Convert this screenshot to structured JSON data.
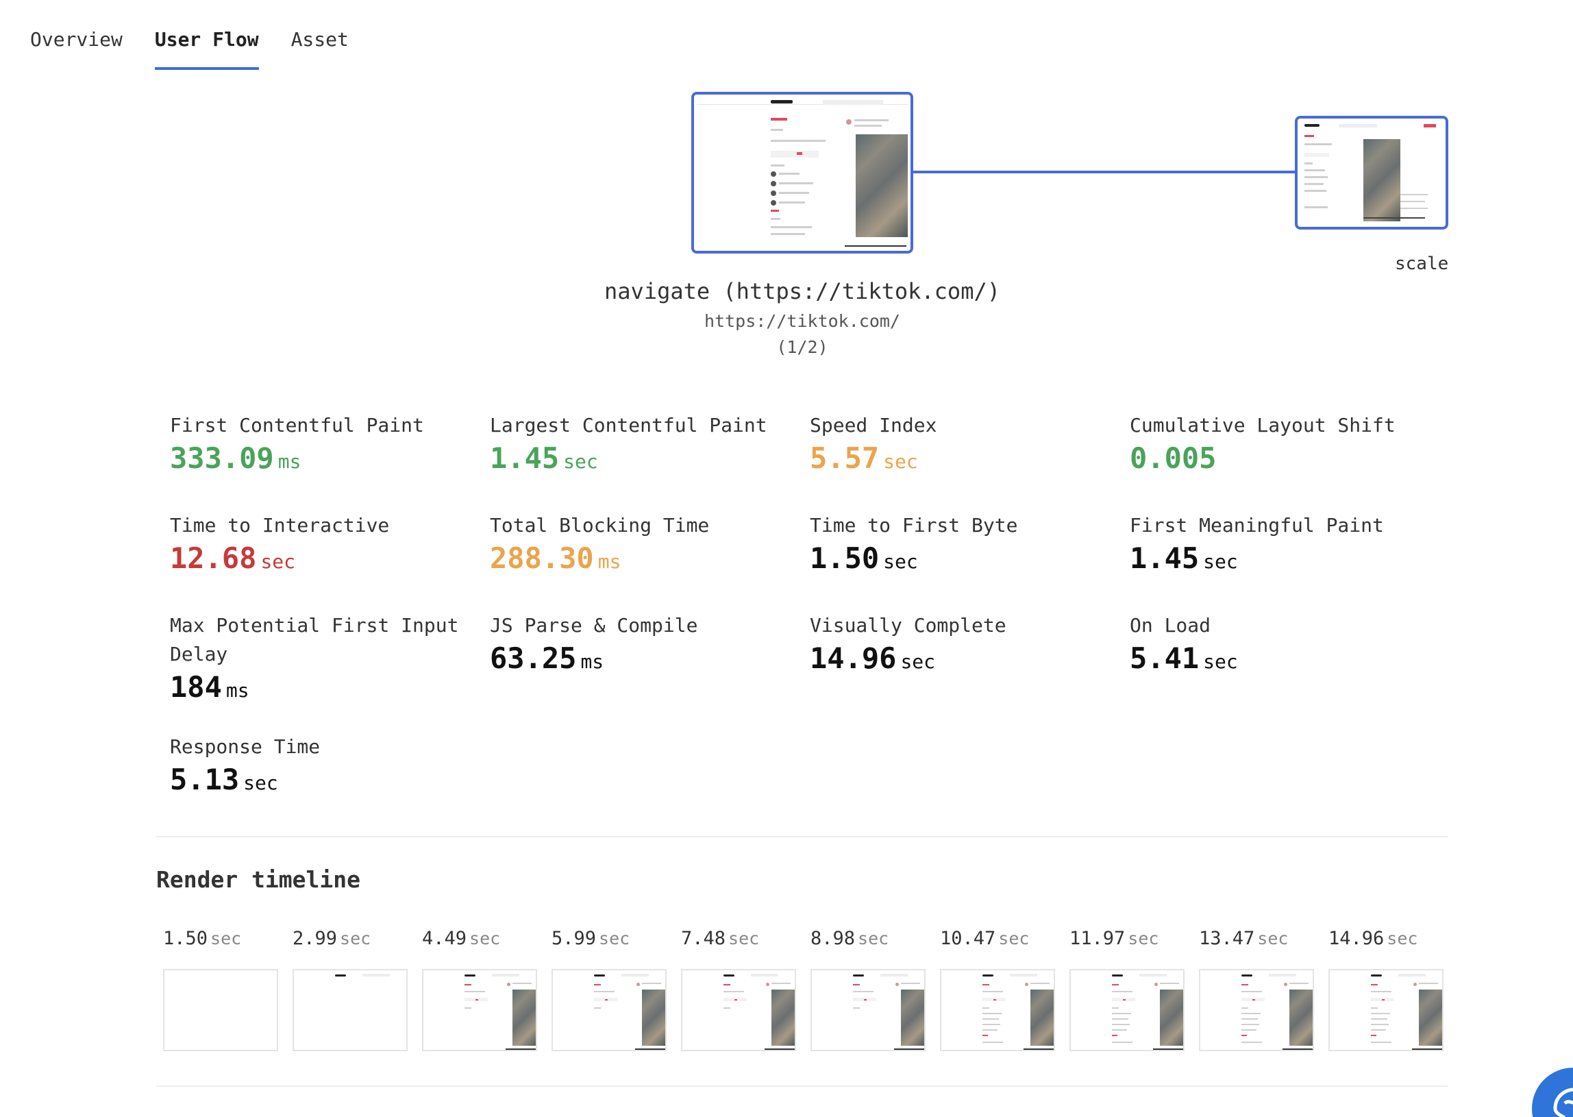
{
  "tabs": [
    {
      "label": "Overview",
      "active": false
    },
    {
      "label": "User Flow",
      "active": true
    },
    {
      "label": "Asset",
      "active": false
    }
  ],
  "flow": {
    "side_label": "scale",
    "step_title": "navigate (https://tiktok.com/)",
    "step_url": "https://tiktok.com/",
    "step_count": "(1/2)",
    "accent": "#4a6ad8"
  },
  "metrics": [
    {
      "label": "First Contentful Paint",
      "value": "333.09",
      "unit": "ms",
      "status": "good"
    },
    {
      "label": "Largest Contentful Paint",
      "value": "1.45",
      "unit": "sec",
      "status": "good"
    },
    {
      "label": "Speed Index",
      "value": "5.57",
      "unit": "sec",
      "status": "avg"
    },
    {
      "label": "Cumulative Layout Shift",
      "value": "0.005",
      "unit": "",
      "status": "good"
    },
    {
      "label": "Time to Interactive",
      "value": "12.68",
      "unit": "sec",
      "status": "bad"
    },
    {
      "label": "Total Blocking Time",
      "value": "288.30",
      "unit": "ms",
      "status": "avg"
    },
    {
      "label": "Time to First Byte",
      "value": "1.50",
      "unit": "sec",
      "status": "neutral"
    },
    {
      "label": "First Meaningful Paint",
      "value": "1.45",
      "unit": "sec",
      "status": "neutral"
    },
    {
      "label": "Max Potential First Input Delay",
      "value": "184",
      "unit": "ms",
      "status": "neutral"
    },
    {
      "label": "JS Parse & Compile",
      "value": "63.25",
      "unit": "ms",
      "status": "neutral"
    },
    {
      "label": "Visually Complete",
      "value": "14.96",
      "unit": "sec",
      "status": "neutral"
    },
    {
      "label": "On Load",
      "value": "5.41",
      "unit": "sec",
      "status": "neutral"
    },
    {
      "label": "Response Time",
      "value": "5.13",
      "unit": "sec",
      "status": "neutral"
    }
  ],
  "render_timeline": {
    "title": "Render timeline",
    "frames": [
      {
        "time": "1.50",
        "unit": "sec",
        "content": "blank"
      },
      {
        "time": "2.99",
        "unit": "sec",
        "content": "header"
      },
      {
        "time": "4.49",
        "unit": "sec",
        "content": "partial"
      },
      {
        "time": "5.99",
        "unit": "sec",
        "content": "partial"
      },
      {
        "time": "7.48",
        "unit": "sec",
        "content": "partial"
      },
      {
        "time": "8.98",
        "unit": "sec",
        "content": "partial"
      },
      {
        "time": "10.47",
        "unit": "sec",
        "content": "full"
      },
      {
        "time": "11.97",
        "unit": "sec",
        "content": "full"
      },
      {
        "time": "13.47",
        "unit": "sec",
        "content": "full"
      },
      {
        "time": "14.96",
        "unit": "sec",
        "content": "full"
      }
    ]
  },
  "status_colors": {
    "good": "#4aa35a",
    "avg": "#eba44c",
    "bad": "#c63a3a",
    "neutral": "#111111"
  },
  "fab_icon": "chat-bubble-icon"
}
